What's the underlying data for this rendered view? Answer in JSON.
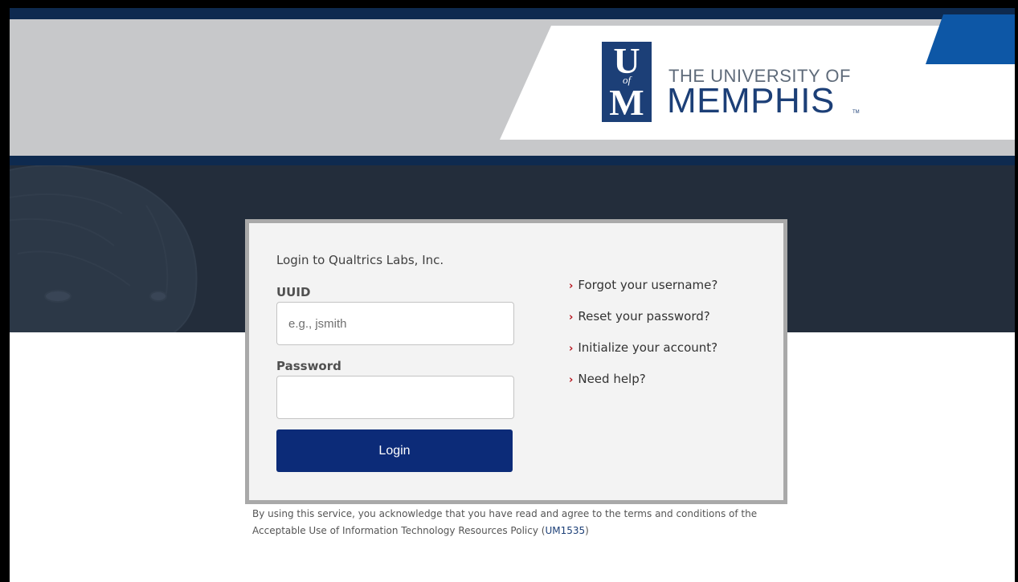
{
  "logo": {
    "mark_u": "U",
    "mark_of": "of",
    "mark_m": "M",
    "line1": "THE UNIVERSITY OF",
    "line2": "MEMPHIS",
    "tm": "TM"
  },
  "login": {
    "title": "Login to Qualtrics Labs, Inc.",
    "uuid_label": "UUID",
    "uuid_placeholder": "e.g., jsmith",
    "password_label": "Password",
    "button_label": "Login"
  },
  "links": [
    {
      "label": "Forgot your username?"
    },
    {
      "label": "Reset your password?"
    },
    {
      "label": "Initialize your account?"
    },
    {
      "label": "Need help?"
    }
  ],
  "disclaimer": {
    "text": "By using this service, you acknowledge that you have read and agree to the terms and conditions of the Acceptable Use of Information Technology Resources Policy (",
    "link": "UM1535",
    "suffix": ")"
  },
  "colors": {
    "navy": "#0e2a4f",
    "brand_blue": "#1c3f77",
    "button": "#0c2b78",
    "accent_blue": "#0d57a6",
    "chevron": "#b5121b"
  }
}
